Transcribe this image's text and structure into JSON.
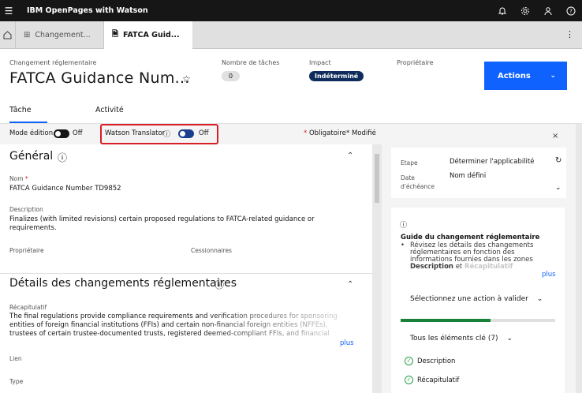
{
  "app": {
    "title": "IBM OpenPages with Watson"
  },
  "topbar": {
    "icons": [
      "notification-icon",
      "settings-icon",
      "user-icon",
      "help-icon"
    ]
  },
  "tabs": [
    {
      "label": "Changement..."
    },
    {
      "label": "FATCA Guid..."
    }
  ],
  "header": {
    "type_label": "Changement réglementaire",
    "title": "FATCA Guidance Num...",
    "tasks_label": "Nombre de tâches",
    "tasks_count": "0",
    "impact_label": "Impact",
    "impact_value": "Indéterminé",
    "owner_label": "Propriétaire",
    "actions_label": "Actions"
  },
  "subtabs": {
    "task": "Tâche",
    "activity": "Activité"
  },
  "toggles": {
    "edit_mode_label": "Mode édition",
    "edit_mode_state": "Off",
    "translator_label": "Watson Translator",
    "translator_state": "Off",
    "required_text": "Obligatoire",
    "modified_text": "Modifié"
  },
  "general": {
    "title": "Général",
    "name_label": "Nom",
    "name_value": "FATCA Guidance Number TD9852",
    "description_label": "Description",
    "description_value": "Finalizes (with limited revisions) certain proposed regulations to FATCA-related guidance or requirements.",
    "owner_label": "Propriétaire",
    "assignees_label": "Cessionnaires"
  },
  "details": {
    "title": "Détails des changements réglementaires",
    "summary_label": "Récapitulatif",
    "summary_value": "The final regulations provide compliance requirements and verification procedures for sponsoring entities of foreign financial institutions (FFIs) and certain non-financial foreign entities (NFFEs), trustees of certain trustee-documented trusts, registered deemed-compliant FFIs, and financial",
    "more_label": "plus",
    "link_label": "Lien",
    "type_label": "Type"
  },
  "right_panel": {
    "stage_label": "Etape",
    "stage_value": "Déterminer l'applicabilité",
    "due_label": "Date d'échéance",
    "due_value": "Nom défini",
    "guide_title": "Guide du changement réglementaire",
    "guide_text": "Révisez les détails des changements réglementaires en fonction des informations fournies dans les zones",
    "guide_bold1": "Description",
    "guide_and": "et",
    "guide_bold2": "Récapitulatif",
    "more_label": "plus",
    "select_action": "Sélectionnez une action à valider",
    "progress": 0.58,
    "key_elements_label": "Tous les éléments clé (7)",
    "checklist": [
      "Description",
      "Récapitulatif"
    ]
  },
  "colors": {
    "primary": "#0f62fe",
    "dark": "#161616",
    "badge": "#0f2d5c",
    "success": "#24a148",
    "highlight": "#da1e28"
  }
}
